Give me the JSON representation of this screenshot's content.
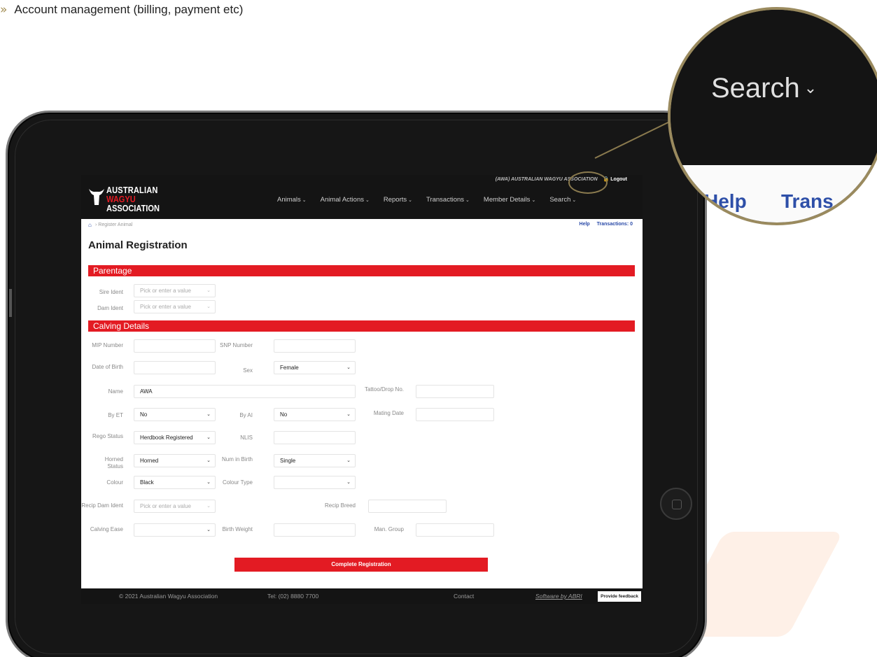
{
  "caption": "Account management (billing, payment etc)",
  "app": {
    "org_line": "(AWA) AUSTRALIAN WAGYU ASSOCIATION",
    "logout": "Logout",
    "logo": [
      "AUSTRALIAN",
      "WAGYU",
      "ASSOCIATION"
    ],
    "nav": [
      "Animals",
      "Animal Actions",
      "Reports",
      "Transactions",
      "Member Details",
      "Search"
    ],
    "breadcrumb": "Register Animal",
    "help": "Help",
    "transactions": "Transactions: 0",
    "title": "Animal Registration"
  },
  "sections": {
    "parentage": "Parentage",
    "calving": "Calving Details"
  },
  "fields": {
    "sire_ident": {
      "label": "Sire Ident",
      "placeholder": "Pick or enter a value"
    },
    "dam_ident": {
      "label": "Dam Ident",
      "placeholder": "Pick or enter a value"
    },
    "mip_number": {
      "label": "MIP Number",
      "value": ""
    },
    "snp_number": {
      "label": "SNP Number",
      "value": ""
    },
    "date_of_birth": {
      "label": "Date of Birth",
      "value": ""
    },
    "sex": {
      "label": "Sex",
      "value": "Female"
    },
    "name": {
      "label": "Name",
      "value": "AWA"
    },
    "tattoo_drop": {
      "label": "Tattoo/Drop No.",
      "value": ""
    },
    "by_et": {
      "label": "By ET",
      "value": "No"
    },
    "by_ai": {
      "label": "By AI",
      "value": "No"
    },
    "mating_date": {
      "label": "Mating Date",
      "value": ""
    },
    "rego_status": {
      "label": "Rego Status",
      "value": "Herdbook Registered"
    },
    "nlis": {
      "label": "NLIS",
      "value": ""
    },
    "horned_status": {
      "label": "Horned Status",
      "value": "Horned"
    },
    "num_in_birth": {
      "label": "Num in Birth",
      "value": "Single"
    },
    "colour": {
      "label": "Colour",
      "value": "Black"
    },
    "colour_type": {
      "label": "Colour Type",
      "value": ""
    },
    "recip_dam_ident": {
      "label": "Recip Dam Ident",
      "placeholder": "Pick or enter a value"
    },
    "recip_breed": {
      "label": "Recip Breed",
      "value": ""
    },
    "calving_ease": {
      "label": "Calving Ease",
      "value": ""
    },
    "birth_weight": {
      "label": "Birth Weight",
      "value": ""
    },
    "man_group": {
      "label": "Man. Group",
      "value": ""
    }
  },
  "submit": "Complete Registration",
  "footer": {
    "copyright": "© 2021 Australian Wagyu Association",
    "tel": "Tel: (02) 8880 7700",
    "contact": "Contact",
    "software": "Software by ABRI",
    "feedback": "Provide feedback"
  },
  "zoom": {
    "search": "Search",
    "help": "Help",
    "trans": "Trans"
  },
  "colors": {
    "brand_red": "#e31b23",
    "gold": "#9a8a5e",
    "link_blue": "#2e4fa8"
  }
}
